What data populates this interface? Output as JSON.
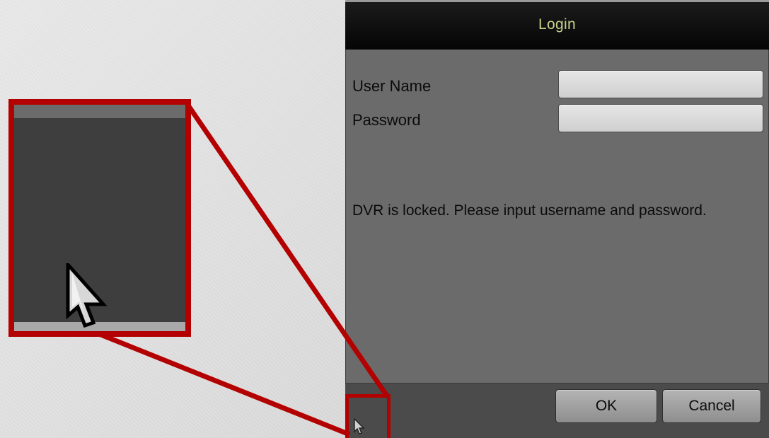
{
  "dialog": {
    "title": "Login",
    "user_name_label": "User Name",
    "password_label": "Password",
    "user_name_value": "",
    "password_value": "",
    "message": "DVR is locked. Please input username and password.",
    "ok_label": "OK",
    "cancel_label": "Cancel"
  },
  "icons": {
    "cursor": "mouse-pointer-icon"
  },
  "colors": {
    "title_text": "#c8d38b",
    "dialog_bg": "#6b6b6b",
    "titlebar_bg": "#0a0a0a",
    "footer_bg": "#4b4b4b",
    "highlight_red": "#b30000"
  }
}
